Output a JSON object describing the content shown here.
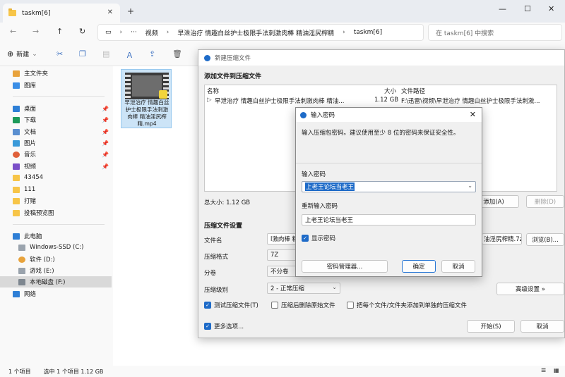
{
  "explorer": {
    "tab_title": "taskm[6]",
    "addr": [
      "视频",
      "早泄治疗 情趣白丝护士极限手法刺激肉棒 精油淫尻榨精",
      "taskm[6]"
    ],
    "search_placeholder": "在 taskm[6] 中搜索",
    "new_label": "新建",
    "sidebar": {
      "top": [
        "主文件夹",
        "图库"
      ],
      "quick": [
        "桌面",
        "下载",
        "文档",
        "图片",
        "音乐",
        "视频",
        "43454",
        "111",
        "打赌",
        "投稿预览图"
      ],
      "pc": "此电脑",
      "drives": [
        "Windows-SSD (C:)",
        "软件 (D:)",
        "游戏 (E:)",
        "本地磁盘 (F:)"
      ],
      "network": "网络"
    },
    "file_name": "早泄治疗 情趣白丝护士极限手法刺激肉棒 精油淫尻榨精.mp4",
    "status": {
      "count": "1 个项目",
      "selected": "选中 1 个项目  1.12 GB"
    }
  },
  "compress": {
    "title": "新建压缩文件",
    "files_header": "添加文件到压缩文件",
    "col_name": "名称",
    "col_size": "大小",
    "col_path": "文件路径",
    "row_name": "早泄治疗 情趣白丝护士极限手法刺激肉棒 精油...",
    "row_size": "1.12 GB",
    "row_path": "F:\\迅雷\\视频\\早泄治疗 情趣白丝护士极限手法刺激...",
    "total": "总大小: 1.12 GB",
    "add_btn": "添加(A)",
    "delete_btn": "删除(D)",
    "settings_header": "压缩文件设置",
    "filename_label": "文件名",
    "filename_value": "l激肉棒 精",
    "filename_tail": "油淫尻榨精.7z",
    "browse_btn": "浏览(B)...",
    "format_label": "压缩格式",
    "format_value": "7Z",
    "split_label": "分卷",
    "split_value": "不分卷",
    "level_label": "压缩级别",
    "level_value": "2 - 正常压缩",
    "advanced_btn": "高级设置 »",
    "chk_test": "测试压缩文件(T)",
    "chk_delete": "压缩后删除原始文件",
    "chk_separate": "把每个文件/文件夹添加到单独的压缩文件",
    "more_options": "更多选项...",
    "start_btn": "开始(S)",
    "cancel_btn": "取消"
  },
  "password": {
    "title": "输入密码",
    "desc": "输入压缩包密码。建议使用至少 8 位的密码来保证安全性。",
    "pw_label": "输入密码",
    "pw_value": "上老王论坛当老王",
    "re_label": "重新输入密码",
    "re_value": "上老王论坛当老王",
    "show_pw": "显示密码",
    "manager_btn": "密码管理器...",
    "ok_btn": "确定",
    "cancel_btn": "取消"
  }
}
